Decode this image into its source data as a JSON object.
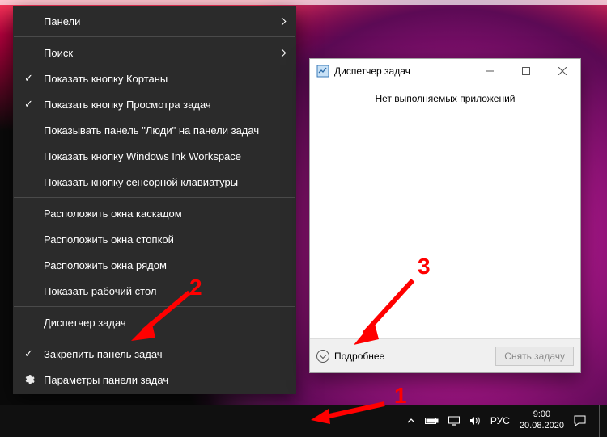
{
  "context_menu": {
    "panels": "Панели",
    "search": "Поиск",
    "show_cortana": "Показать кнопку Кортаны",
    "show_taskview": "Показать кнопку Просмотра задач",
    "show_people": "Показывать панель \"Люди\" на панели задач",
    "show_ink": "Показать кнопку Windows Ink Workspace",
    "show_touchkbd": "Показать кнопку сенсорной клавиатуры",
    "cascade": "Расположить окна каскадом",
    "stack": "Расположить окна стопкой",
    "sidebyside": "Расположить окна рядом",
    "show_desktop": "Показать рабочий стол",
    "task_manager": "Диспетчер задач",
    "lock_taskbar": "Закрепить панель задач",
    "settings": "Параметры панели задач"
  },
  "task_manager": {
    "title": "Диспетчер задач",
    "empty": "Нет выполняемых приложений",
    "more": "Подробнее",
    "end_task": "Снять задачу"
  },
  "tray": {
    "lang": "РУС",
    "time": "9:00",
    "date": "20.08.2020"
  },
  "annotations": {
    "a1": "1",
    "a2": "2",
    "a3": "3"
  }
}
